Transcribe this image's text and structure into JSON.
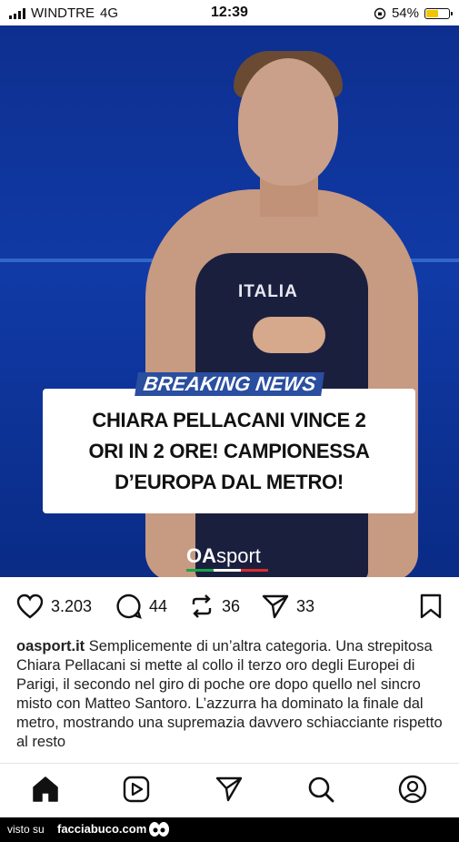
{
  "status_bar": {
    "carrier": "WINDTRE",
    "network": "4G",
    "time": "12:39",
    "battery": "54%"
  },
  "post": {
    "image_text": {
      "breaking_tag": "BREAKING NEWS",
      "headline": "CHIARA PELLACANI VINCE 2\nORI IN 2 ORE! CAMPIONESSA\nD’EUROPA DAL METRO!",
      "suit_text": "ITALIA",
      "logo_main": "OA",
      "logo_sub": "sport"
    },
    "likes": "3.203",
    "comments": "44",
    "reposts": "36",
    "shares": "33",
    "username": "oasport.it",
    "caption": "Semplicemente di un’altra categoria. Una strepitosa Chiara Pellacani si mette al collo il terzo oro degli Europei di Parigi, il secondo nel giro di poche ore dopo quello nel sincro misto con Matteo Santoro. L’azzurra ha dominato la finale dal metro, mostrando una supremazia davvero schiacciante rispetto al resto"
  },
  "tabs": [
    "home-icon",
    "reels-icon",
    "send-icon",
    "search-icon",
    "profile-icon"
  ],
  "footer": {
    "visto": "visto su",
    "site": "facciabuco.com"
  },
  "colors": {
    "photo_bg": "#103aa6",
    "badge_blue": "#2a4ea0",
    "battery_fill": "#f2c500"
  }
}
